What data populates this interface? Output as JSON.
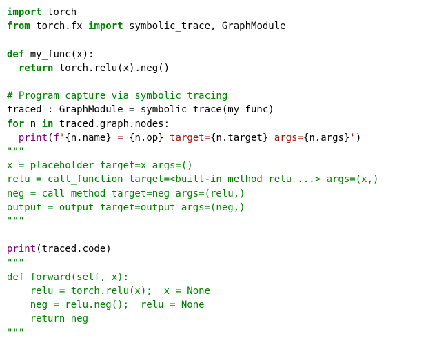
{
  "code": {
    "line1": {
      "kw1": "import",
      "mod1": " torch"
    },
    "line2": {
      "kw1": "from",
      "mod1": " torch.fx ",
      "kw2": "import",
      "names": " symbolic_trace, GraphModule"
    },
    "line3": "",
    "line4": {
      "kw1": "def",
      "sig": " my_func(x):"
    },
    "line5": {
      "indent": "  ",
      "kw1": "return",
      "rest": " torch.relu(x).neg()"
    },
    "line6": "",
    "line7": {
      "comment": "# Program capture via symbolic tracing"
    },
    "line8": {
      "text": "traced : GraphModule = symbolic_trace(my_func)"
    },
    "line9": {
      "kw1": "for",
      "mid": " n ",
      "kw2": "in",
      "rest": " traced.graph.nodes:"
    },
    "line10": {
      "indent": "  ",
      "fn": "print",
      "open": "(",
      "fpre": "f",
      "q1": "'",
      "i1": "{n.name}",
      "s1": " = ",
      "i2": "{n.op}",
      "s2": " target=",
      "i3": "{n.target}",
      "s3": " args=",
      "i4": "{n.args}",
      "q2": "'",
      "close": ")"
    },
    "line11": {
      "doc": "\"\"\""
    },
    "line12": {
      "doc": "x = placeholder target=x args=()"
    },
    "line13": {
      "doc": "relu = call_function target=<built-in method relu ...> args=(x,)"
    },
    "line14": {
      "doc": "neg = call_method target=neg args=(relu,)"
    },
    "line15": {
      "doc": "output = output target=output args=(neg,)"
    },
    "line16": {
      "doc": "\"\"\""
    },
    "line17": "",
    "line18": {
      "fn": "print",
      "arg": "(traced.code)"
    },
    "line19": {
      "doc": "\"\"\""
    },
    "line20": {
      "kw1": "def",
      "sig": " forward(self, x):",
      "docmode": true
    },
    "line21": {
      "doc": "    relu = torch.relu(x);  x = None"
    },
    "line22": {
      "doc": "    neg = relu.neg();  relu = None"
    },
    "line23": {
      "doc": "    return neg"
    },
    "line24": {
      "doc": "\"\"\""
    }
  }
}
